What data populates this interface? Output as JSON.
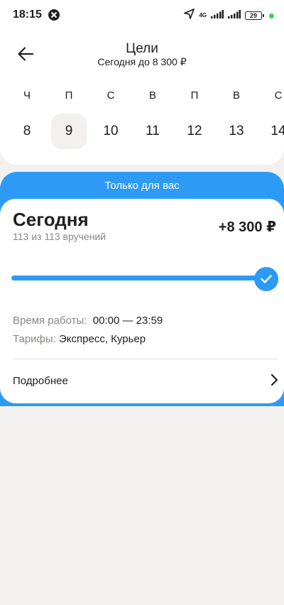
{
  "status": {
    "time": "18:15",
    "network": "4G",
    "battery": "29"
  },
  "header": {
    "title": "Цели",
    "subtitle": "Сегодня до 8 300 ₽"
  },
  "calendar": {
    "days": [
      {
        "weekday": "Ч",
        "date": "8",
        "selected": false
      },
      {
        "weekday": "П",
        "date": "9",
        "selected": true
      },
      {
        "weekday": "С",
        "date": "10",
        "selected": false
      },
      {
        "weekday": "В",
        "date": "11",
        "selected": false
      },
      {
        "weekday": "П",
        "date": "12",
        "selected": false
      },
      {
        "weekday": "В",
        "date": "13",
        "selected": false
      },
      {
        "weekday": "С",
        "date": "14",
        "selected": false
      }
    ]
  },
  "promo": {
    "label": "Только для вас"
  },
  "card": {
    "title": "Сегодня",
    "progress_text": "113 из 113 вручений",
    "amount": "+8 300 ₽",
    "progress": 1.0,
    "work_time_label": "Время работы:",
    "work_time_value": "00:00 — 23:59",
    "tariffs_label": "Тарифы:",
    "tariffs_value": "Экспресс, Курьер",
    "more_label": "Подробнее"
  },
  "colors": {
    "accent": "#2d9bf5",
    "background": "#f2f1ef",
    "muted": "#8a8784"
  }
}
